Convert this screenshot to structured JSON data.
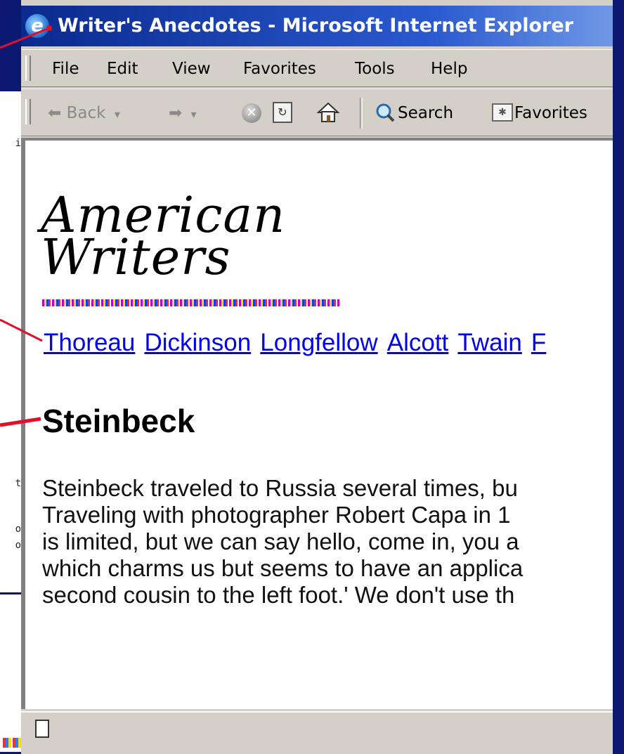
{
  "window": {
    "title": "Writer's Anecdotes - Microsoft Internet Explorer"
  },
  "menubar": {
    "items": [
      "File",
      "Edit",
      "View",
      "Favorites",
      "Tools",
      "Help"
    ]
  },
  "toolbar": {
    "back_label": "Back",
    "search_label": "Search",
    "favorites_label": "Favorites"
  },
  "page": {
    "logo_line1": "American",
    "logo_line2": "Writers",
    "nav_links": [
      "Thoreau",
      "Dickinson",
      "Longfellow",
      "Alcott",
      "Twain",
      "F"
    ],
    "heading": "Steinbeck",
    "body_lines": [
      "Steinbeck traveled to Russia several times, bu",
      "Traveling with photographer Robert Capa in 1",
      "is limited, but we can say hello, come in, you a",
      "which charms us but seems to have an applica",
      "second cousin to the left foot.' We don't use th"
    ]
  },
  "background": {
    "fragments": [
      "i",
      "t",
      "o",
      "o"
    ]
  },
  "colors": {
    "slide_bg": "#0a1872",
    "link": "#0000ee",
    "callout": "#e0102a"
  }
}
